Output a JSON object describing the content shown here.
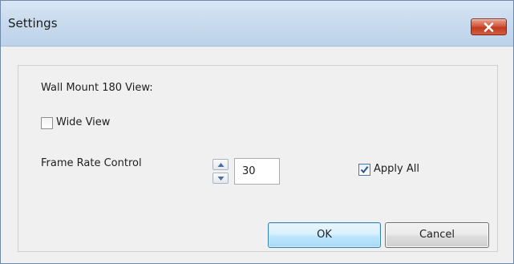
{
  "window": {
    "title": "Settings",
    "close_icon": "close-icon"
  },
  "group": {
    "heading": "Wall Mount 180 View:",
    "wide_view": {
      "label": "Wide View",
      "checked": false
    },
    "frame_rate": {
      "label": "Frame Rate Control",
      "value": "30",
      "up_icon": "chevron-up-icon",
      "down_icon": "chevron-down-icon"
    },
    "apply_all": {
      "label": "Apply All",
      "checked": true
    }
  },
  "buttons": {
    "ok": "OK",
    "cancel": "Cancel"
  },
  "colors": {
    "title_bar": "#c9dbee",
    "close_button": "#c9472b",
    "default_button": "#bee6fd",
    "checkmark": "#2c4f8a"
  }
}
